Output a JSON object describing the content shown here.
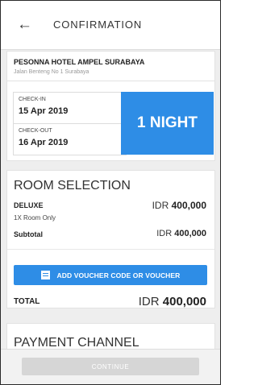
{
  "appbar": {
    "back_icon": "←",
    "title": "CONFIRMATION"
  },
  "hotel": {
    "name": "PESONNA HOTEL AMPEL SURABAYA",
    "address": "Jalan Benteng No 1 Surabaya",
    "checkin_label": "CHECK-IN",
    "checkin_date": "15 Apr 2019",
    "checkout_label": "CHECK-OUT",
    "checkout_date": "16 Apr 2019",
    "nights": "1 NIGHT"
  },
  "room": {
    "section_title": "ROOM SELECTION",
    "type": "DELUXE",
    "description": "1X Room Only",
    "price_currency": "IDR",
    "price_amount": "400,000",
    "subtotal_label": "Subtotal",
    "subtotal_currency": "IDR",
    "subtotal_amount": "400,000",
    "voucher_button": "ADD VOUCHER CODE OR VOUCHER",
    "total_label": "TOTAL",
    "total_currency": "IDR",
    "total_amount": "400,000"
  },
  "payment": {
    "section_title": "PAYMENT CHANNEL"
  },
  "footer": {
    "continue_button": "CONTINUE"
  },
  "colors": {
    "accent": "#2e8de6",
    "disabled": "#d6d6d6",
    "background": "#eeeeee"
  }
}
